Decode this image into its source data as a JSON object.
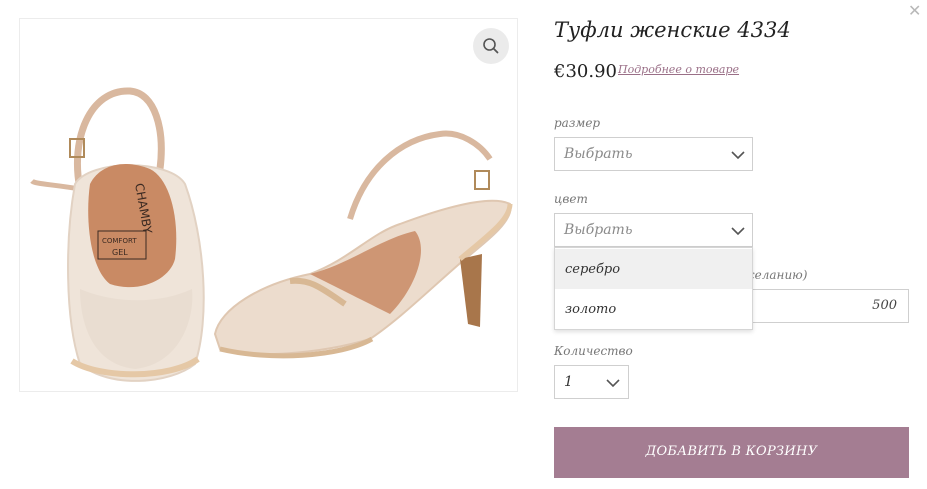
{
  "close_icon": "close-icon",
  "product": {
    "title": "Туфли женские 4334",
    "price": "€30.90",
    "more_link": "Подробнее о товаре",
    "image_alt_brand": "CHAMBY",
    "insole_text_1": "COMFORT",
    "insole_text_2": "GEL"
  },
  "size": {
    "label": "размер",
    "placeholder": "Выбрать"
  },
  "color": {
    "label": "цвет",
    "placeholder": "Выбрать",
    "options": [
      "серебро",
      "золото"
    ]
  },
  "extra": {
    "label_visible_part": "желанию)",
    "value": "500"
  },
  "quantity": {
    "label": "Количество",
    "value": "1"
  },
  "cart_button": "ДОБАВИТЬ В КОРЗИНУ",
  "colors": {
    "accent": "#a47d92",
    "link": "#9a6f87"
  }
}
